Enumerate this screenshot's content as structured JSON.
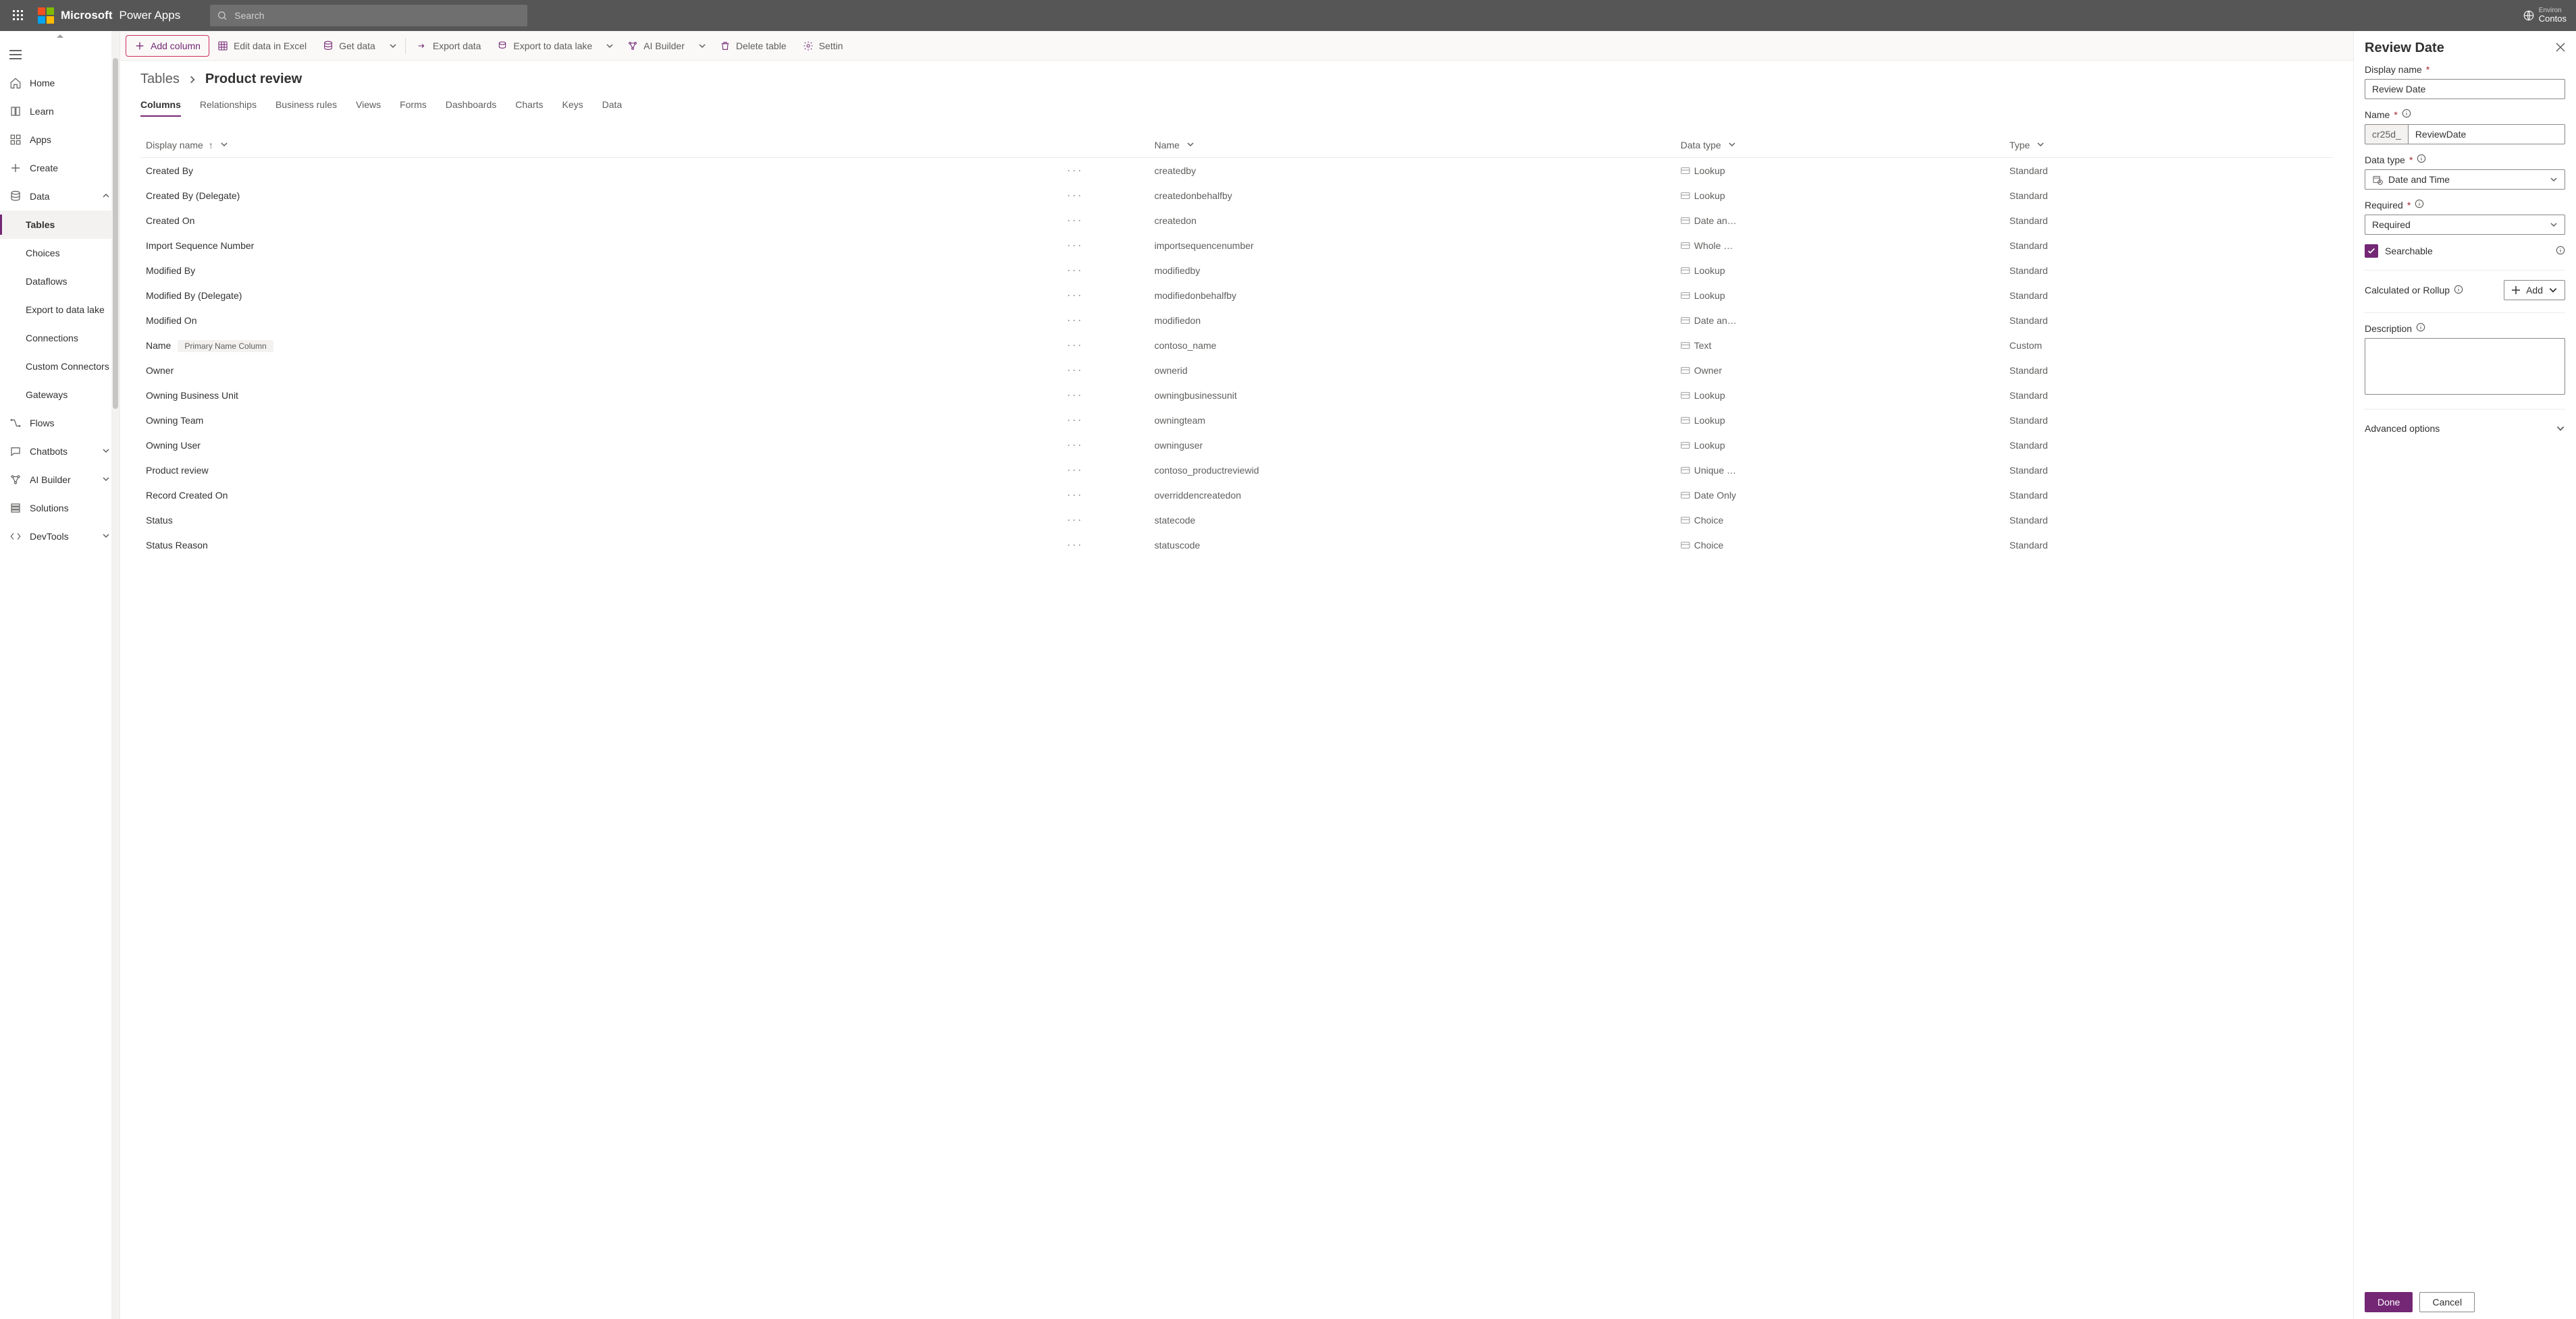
{
  "header": {
    "brand": "Microsoft",
    "product": "Power Apps",
    "search_placeholder": "Search",
    "env_label": "Environ",
    "env_name": "Contos"
  },
  "nav": {
    "items": [
      {
        "icon": "home",
        "label": "Home"
      },
      {
        "icon": "book",
        "label": "Learn"
      },
      {
        "icon": "grid",
        "label": "Apps"
      },
      {
        "icon": "plus",
        "label": "Create"
      },
      {
        "icon": "db",
        "label": "Data",
        "expand": true,
        "open": true,
        "children": [
          {
            "label": "Tables",
            "selected": true
          },
          {
            "label": "Choices"
          },
          {
            "label": "Dataflows"
          },
          {
            "label": "Export to data lake"
          },
          {
            "label": "Connections"
          },
          {
            "label": "Custom Connectors"
          },
          {
            "label": "Gateways"
          }
        ]
      },
      {
        "icon": "flow",
        "label": "Flows"
      },
      {
        "icon": "chat",
        "label": "Chatbots",
        "expand": true
      },
      {
        "icon": "ai",
        "label": "AI Builder",
        "expand": true
      },
      {
        "icon": "sol",
        "label": "Solutions"
      },
      {
        "icon": "dev",
        "label": "DevTools",
        "expand": true
      }
    ]
  },
  "toolbar": {
    "add_column": "Add column",
    "edit_excel": "Edit data in Excel",
    "get_data": "Get data",
    "export_data": "Export data",
    "export_lake": "Export to data lake",
    "ai_builder": "AI Builder",
    "delete_table": "Delete table",
    "settings": "Settin"
  },
  "breadcrumb": {
    "parent": "Tables",
    "current": "Product review"
  },
  "tabs": [
    "Columns",
    "Relationships",
    "Business rules",
    "Views",
    "Forms",
    "Dashboards",
    "Charts",
    "Keys",
    "Data"
  ],
  "active_tab": "Columns",
  "table": {
    "headers": {
      "display_name": "Display name",
      "name": "Name",
      "data_type": "Data type",
      "type": "Type"
    },
    "rows": [
      {
        "dn": "Created By",
        "name": "createdby",
        "dtype": "Lookup",
        "type": "Standard"
      },
      {
        "dn": "Created By (Delegate)",
        "name": "createdonbehalfby",
        "dtype": "Lookup",
        "type": "Standard"
      },
      {
        "dn": "Created On",
        "name": "createdon",
        "dtype": "Date an…",
        "type": "Standard"
      },
      {
        "dn": "Import Sequence Number",
        "name": "importsequencenumber",
        "dtype": "Whole …",
        "type": "Standard"
      },
      {
        "dn": "Modified By",
        "name": "modifiedby",
        "dtype": "Lookup",
        "type": "Standard"
      },
      {
        "dn": "Modified By (Delegate)",
        "name": "modifiedonbehalfby",
        "dtype": "Lookup",
        "type": "Standard"
      },
      {
        "dn": "Modified On",
        "name": "modifiedon",
        "dtype": "Date an…",
        "type": "Standard"
      },
      {
        "dn": "Name",
        "name": "contoso_name",
        "dtype": "Text",
        "type": "Custom",
        "primary": true
      },
      {
        "dn": "Owner",
        "name": "ownerid",
        "dtype": "Owner",
        "type": "Standard"
      },
      {
        "dn": "Owning Business Unit",
        "name": "owningbusinessunit",
        "dtype": "Lookup",
        "type": "Standard"
      },
      {
        "dn": "Owning Team",
        "name": "owningteam",
        "dtype": "Lookup",
        "type": "Standard"
      },
      {
        "dn": "Owning User",
        "name": "owninguser",
        "dtype": "Lookup",
        "type": "Standard"
      },
      {
        "dn": "Product review",
        "name": "contoso_productreviewid",
        "dtype": "Unique …",
        "type": "Standard"
      },
      {
        "dn": "Record Created On",
        "name": "overriddencreatedon",
        "dtype": "Date Only",
        "type": "Standard"
      },
      {
        "dn": "Status",
        "name": "statecode",
        "dtype": "Choice",
        "type": "Standard"
      },
      {
        "dn": "Status Reason",
        "name": "statuscode",
        "dtype": "Choice",
        "type": "Standard"
      }
    ],
    "primary_badge": "Primary Name Column"
  },
  "panel": {
    "title": "Review Date",
    "display_name_label": "Display name",
    "display_name_value": "Review Date",
    "name_label": "Name",
    "name_prefix": "cr25d_",
    "name_value": "ReviewDate",
    "data_type_label": "Data type",
    "data_type_value": "Date and Time",
    "required_label": "Required",
    "required_value": "Required",
    "searchable_label": "Searchable",
    "calc_label": "Calculated or Rollup",
    "add_label": "Add",
    "description_label": "Description",
    "advanced_label": "Advanced options",
    "done": "Done",
    "cancel": "Cancel"
  }
}
